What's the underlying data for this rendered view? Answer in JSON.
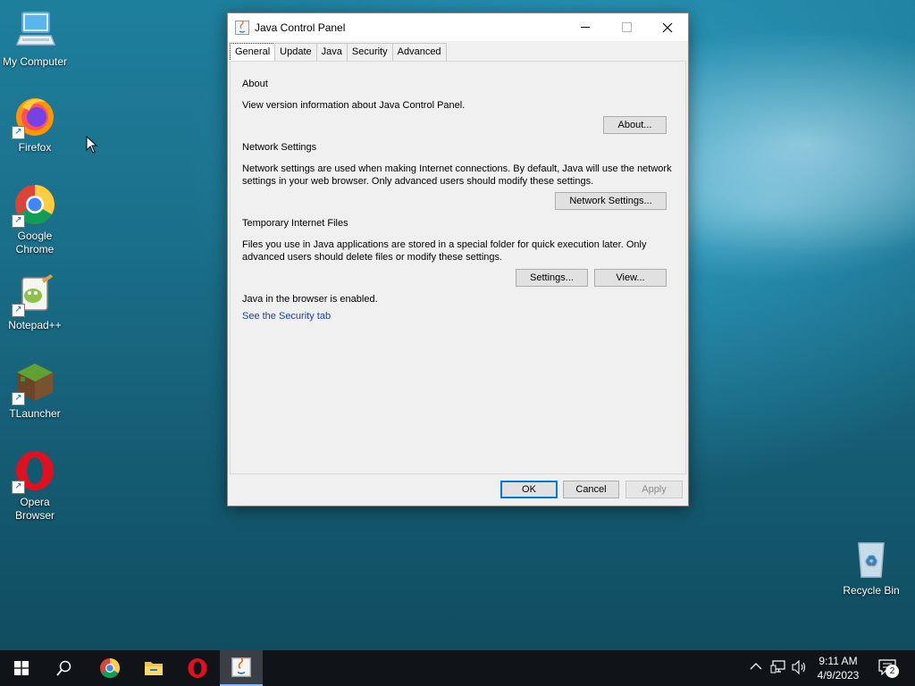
{
  "desktop": {
    "icons": [
      {
        "label": "My Computer"
      },
      {
        "label": "Firefox"
      },
      {
        "label": "Google Chrome"
      },
      {
        "label": "Notepad++"
      },
      {
        "label": "TLauncher"
      },
      {
        "label": "Opera Browser"
      },
      {
        "label": "Recycle Bin"
      }
    ]
  },
  "window": {
    "title": "Java Control Panel",
    "tabs": [
      {
        "label": "General",
        "active": true
      },
      {
        "label": "Update"
      },
      {
        "label": "Java"
      },
      {
        "label": "Security"
      },
      {
        "label": "Advanced"
      }
    ],
    "sections": {
      "about_heading": "About",
      "about_text": "View version information about Java Control Panel.",
      "about_button": "About...",
      "network_heading": "Network Settings",
      "network_text_1": "Network settings are used when making Internet connections. By default, Java will use the network",
      "network_text_2": "settings in your web browser. Only advanced users should modify these settings.",
      "network_button": "Network Settings...",
      "temp_heading": "Temporary Internet Files",
      "temp_text_1": "Files you use in Java applications are stored in a special folder for quick execution later. Only",
      "temp_text_2": "advanced users should delete files or modify these settings.",
      "settings_button": "Settings...",
      "view_button": "View...",
      "browser_status": "Java in the browser is enabled.",
      "security_link": "See the Security tab"
    },
    "footer": {
      "ok": "OK",
      "cancel": "Cancel",
      "apply": "Apply"
    }
  },
  "taskbar": {
    "clock_time": "9:11 AM",
    "clock_date": "4/9/2023",
    "notification_count": "2",
    "pinned": [
      "start-icon",
      "search-icon",
      "chrome-icon",
      "file-explorer-icon",
      "opera-icon",
      "java-icon"
    ]
  }
}
